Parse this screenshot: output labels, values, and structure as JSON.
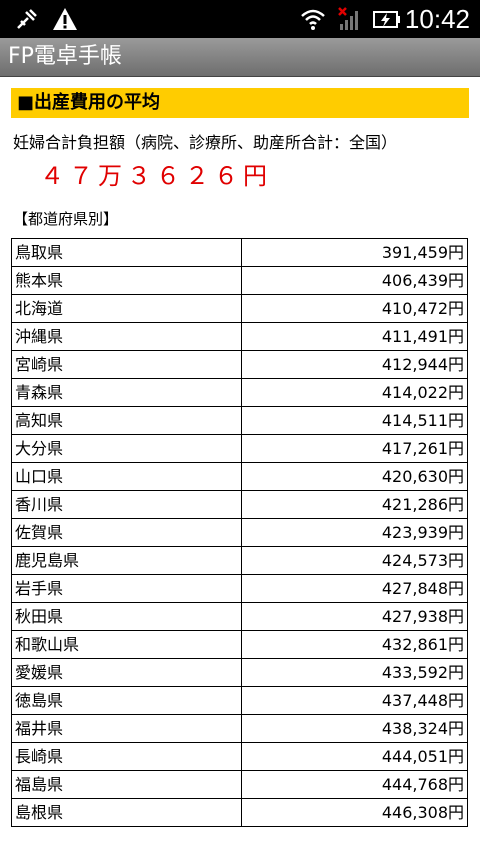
{
  "statusbar": {
    "time": "10:42"
  },
  "app": {
    "title": "FP電卓手帳"
  },
  "section": {
    "header": "■出産費用の平均",
    "description": "妊婦合計負担額（病院、診療所、助産所合計：全国）",
    "total": "４７万３６２６円",
    "subheader": "【都道府県別】"
  },
  "rows": [
    {
      "name": "鳥取県",
      "value": "391,459円"
    },
    {
      "name": "熊本県",
      "value": "406,439円"
    },
    {
      "name": "北海道",
      "value": "410,472円"
    },
    {
      "name": "沖縄県",
      "value": "411,491円"
    },
    {
      "name": "宮崎県",
      "value": "412,944円"
    },
    {
      "name": "青森県",
      "value": "414,022円"
    },
    {
      "name": "高知県",
      "value": "414,511円"
    },
    {
      "name": "大分県",
      "value": "417,261円"
    },
    {
      "name": "山口県",
      "value": "420,630円"
    },
    {
      "name": "香川県",
      "value": "421,286円"
    },
    {
      "name": "佐賀県",
      "value": "423,939円"
    },
    {
      "name": "鹿児島県",
      "value": "424,573円"
    },
    {
      "name": "岩手県",
      "value": "427,848円"
    },
    {
      "name": "秋田県",
      "value": "427,938円"
    },
    {
      "name": "和歌山県",
      "value": "432,861円"
    },
    {
      "name": "愛媛県",
      "value": "433,592円"
    },
    {
      "name": "徳島県",
      "value": "437,448円"
    },
    {
      "name": "福井県",
      "value": "438,324円"
    },
    {
      "name": "長崎県",
      "value": "444,051円"
    },
    {
      "name": "福島県",
      "value": "444,768円"
    },
    {
      "name": "島根県",
      "value": "446,308円"
    }
  ]
}
